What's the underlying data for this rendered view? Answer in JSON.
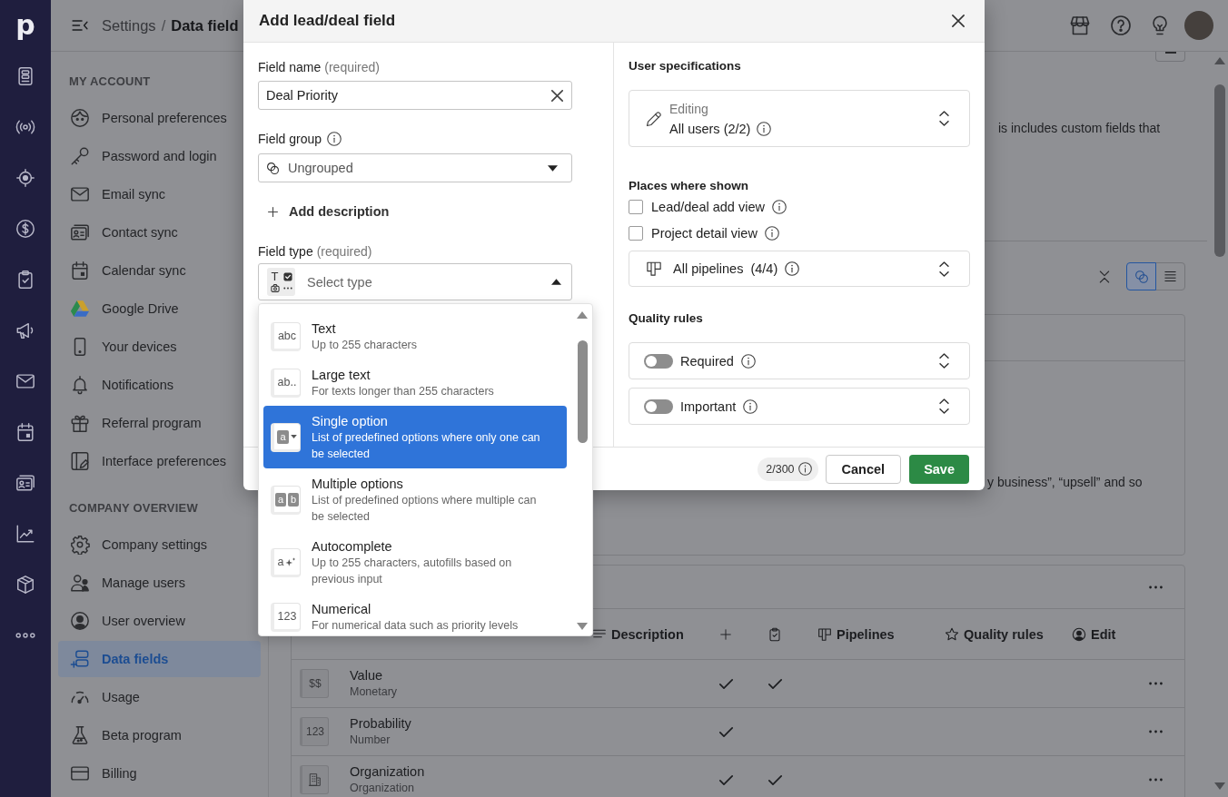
{
  "rail": {
    "logo": "p"
  },
  "header": {
    "section": "Settings",
    "separator": "/",
    "page": "Data field"
  },
  "sidebar": {
    "sections": [
      {
        "title": "MY ACCOUNT",
        "items": [
          {
            "label": "Personal preferences",
            "selected": false
          },
          {
            "label": "Password and login",
            "selected": false
          },
          {
            "label": "Email sync",
            "selected": false
          },
          {
            "label": "Contact sync",
            "selected": false
          },
          {
            "label": "Calendar sync",
            "selected": false
          },
          {
            "label": "Google Drive",
            "selected": false
          },
          {
            "label": "Your devices",
            "selected": false
          },
          {
            "label": "Notifications",
            "selected": false
          },
          {
            "label": "Referral program",
            "selected": false
          },
          {
            "label": "Interface preferences",
            "selected": false
          }
        ]
      },
      {
        "title": "COMPANY OVERVIEW",
        "items": [
          {
            "label": "Company settings",
            "selected": false
          },
          {
            "label": "Manage users",
            "selected": false
          },
          {
            "label": "User overview",
            "selected": false
          },
          {
            "label": "Data fields",
            "selected": true
          },
          {
            "label": "Usage",
            "selected": false
          },
          {
            "label": "Beta program",
            "selected": false
          },
          {
            "label": "Billing",
            "selected": false
          }
        ]
      }
    ]
  },
  "main": {
    "intro_fragment": "is includes custom fields that",
    "view_modes": [
      {
        "selected": true
      },
      {
        "selected": false
      }
    ],
    "card_fragment": "y business”, “upsell” and so",
    "table": {
      "columns": {
        "description": "Description",
        "pipelines": "Pipelines",
        "quality_rules": "Quality rules",
        "edit": "Edit"
      },
      "rows": [
        {
          "name": "Value",
          "type": "Monetary",
          "kind": "glyph",
          "glyph": "$$",
          "add_view": true,
          "detail_view": true
        },
        {
          "name": "Probability",
          "type": "Number",
          "kind": "glyph",
          "glyph": "123",
          "add_view": true,
          "detail_view": false
        },
        {
          "name": "Organization",
          "type": "Organization",
          "kind": "building",
          "add_view": true,
          "detail_view": true
        }
      ]
    }
  },
  "modal": {
    "title": "Add lead/deal field"
  },
  "field_name": {
    "label": "Field name",
    "note": "(required)",
    "value": "Deal Priority"
  },
  "field_group": {
    "label": "Field group",
    "value": "Ungrouped"
  },
  "add_description": "Add description",
  "field_type": {
    "label": "Field type",
    "note": "(required)",
    "icon_letter": "T",
    "placeholder": "Select type",
    "expanded": true,
    "options": [
      {
        "title": "Text",
        "description": "Up to 255 characters",
        "kind": "plain",
        "glyph": "abc",
        "selected": false
      },
      {
        "title": "Large text",
        "description": "For texts longer than 255 characters",
        "kind": "plain",
        "glyph": "ab..",
        "selected": false
      },
      {
        "title": "Single option",
        "description": "List of predefined options where only one can be selected",
        "kind": "single",
        "glyph": "a",
        "selected": true
      },
      {
        "title": "Multiple options",
        "description": "List of predefined options where multiple can be selected",
        "kind": "multiple",
        "glyphs": [
          "a",
          "b"
        ],
        "selected": false
      },
      {
        "title": "Autocomplete",
        "description": "Up to 255 characters, autofills based on previous input",
        "kind": "autocomplete",
        "glyph": "a",
        "selected": false
      },
      {
        "title": "Numerical",
        "description": "For numerical data such as priority levels",
        "kind": "plain",
        "glyph": "123",
        "selected": false
      }
    ]
  },
  "user_specifications": {
    "title": "User specifications",
    "label": "Editing",
    "value": "All users (2/2)"
  },
  "places": {
    "title": "Places where shown",
    "options": [
      {
        "label": "Lead/deal add view",
        "checked": false
      },
      {
        "label": "Project detail view",
        "checked": false
      }
    ],
    "pipelines": {
      "label": "All pipelines",
      "count": "(4/4)"
    }
  },
  "quality_rules": {
    "title": "Quality rules",
    "rules": [
      {
        "label": "Required",
        "on": false
      },
      {
        "label": "Important",
        "on": false
      }
    ]
  },
  "footer": {
    "counter": "2/300",
    "cancel": "Cancel",
    "save": "Save"
  }
}
